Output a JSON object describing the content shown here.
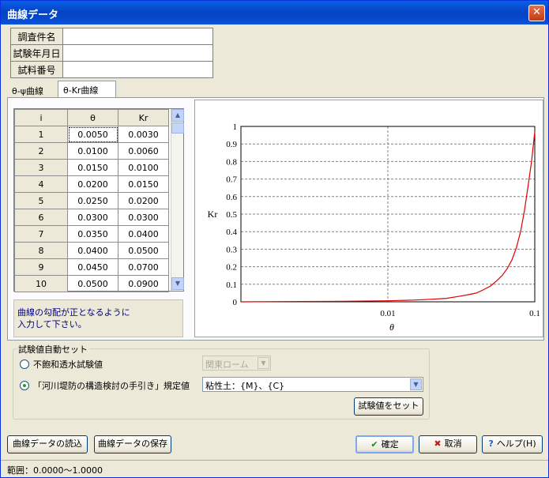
{
  "window": {
    "title": "曲線データ",
    "close_symbol": "✕"
  },
  "info": [
    {
      "label": "調査件名",
      "value": ""
    },
    {
      "label": "試験年月日",
      "value": ""
    },
    {
      "label": "試料番号",
      "value": ""
    }
  ],
  "tabs": [
    {
      "label": "θ-ψ曲線"
    },
    {
      "label": "θ-Kr曲線",
      "active": true
    }
  ],
  "grid": {
    "columns": [
      "i",
      "θ",
      "Kr"
    ],
    "rows": [
      [
        "1",
        "0.0050",
        "0.0030"
      ],
      [
        "2",
        "0.0100",
        "0.0060"
      ],
      [
        "3",
        "0.0150",
        "0.0100"
      ],
      [
        "4",
        "0.0200",
        "0.0150"
      ],
      [
        "5",
        "0.0250",
        "0.0200"
      ],
      [
        "6",
        "0.0300",
        "0.0300"
      ],
      [
        "7",
        "0.0350",
        "0.0400"
      ],
      [
        "8",
        "0.0400",
        "0.0500"
      ],
      [
        "9",
        "0.0450",
        "0.0700"
      ],
      [
        "10",
        "0.0500",
        "0.0900"
      ]
    ]
  },
  "hint": {
    "line1": "曲線の勾配が正となるように",
    "line2": "入力して下さい。"
  },
  "chart_data": {
    "type": "line",
    "xlabel": "θ",
    "ylabel": "Kr",
    "x_scale": "log",
    "xlim": [
      0.001,
      0.1
    ],
    "ylim": [
      0,
      1
    ],
    "x_ticks": [
      "0.01",
      "0.1"
    ],
    "y_ticks": [
      "0",
      "0.1",
      "0.2",
      "0.3",
      "0.4",
      "0.5",
      "0.6",
      "0.7",
      "0.8",
      "0.9",
      "1"
    ],
    "grid": true,
    "line_color": "#e00000",
    "series": [
      {
        "x": [
          0.001,
          0.005,
          0.01,
          0.015,
          0.02,
          0.025,
          0.03,
          0.035,
          0.04,
          0.045,
          0.05,
          0.055,
          0.06,
          0.065,
          0.07,
          0.075,
          0.08,
          0.085,
          0.09,
          0.095,
          0.1
        ],
        "values": [
          0.0,
          0.003,
          0.006,
          0.01,
          0.015,
          0.02,
          0.03,
          0.04,
          0.05,
          0.07,
          0.09,
          0.12,
          0.15,
          0.19,
          0.24,
          0.31,
          0.4,
          0.52,
          0.66,
          0.8,
          0.97
        ]
      }
    ]
  },
  "auto_set": {
    "group_label": "試験値自動セット",
    "option1_label": "不飽和透水試験値",
    "option1_combo": "関東ローム",
    "option2_label": "「河川堤防の構造検討の手引き」規定値",
    "option2_combo": "粘性土：{M}、{C}",
    "set_button": "試験値をセット"
  },
  "buttons": {
    "load": "曲線データの読込",
    "save": "曲線データの保存",
    "ok": "確定",
    "cancel": "取消",
    "help": "ヘルプ(H)"
  },
  "status": "範囲：0.0000～1.0000"
}
